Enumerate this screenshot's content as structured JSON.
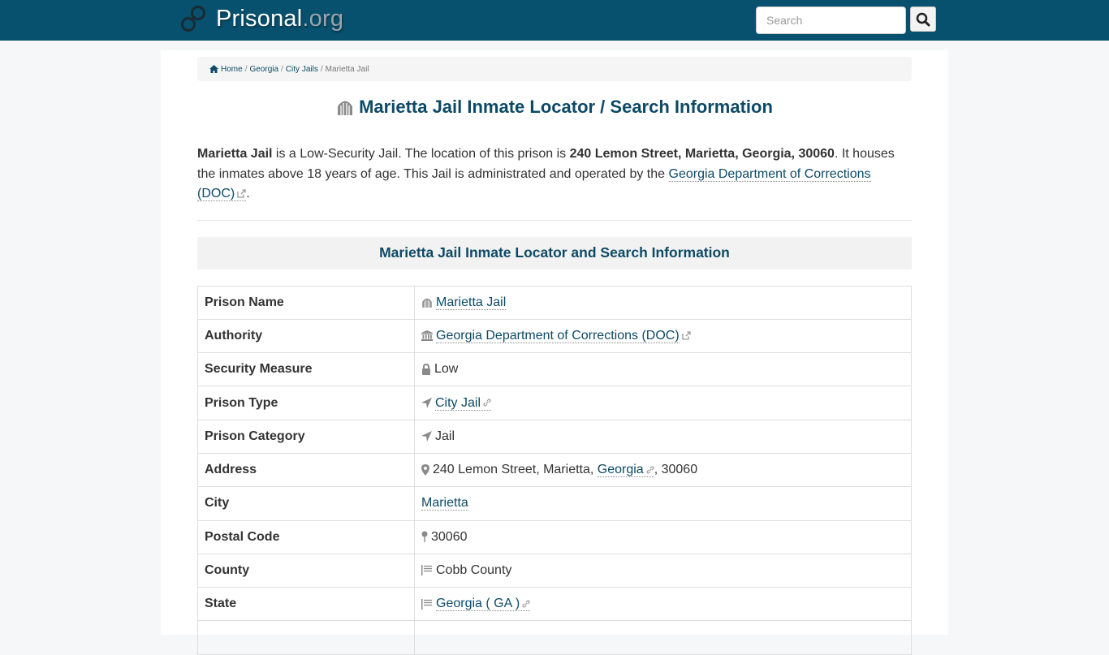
{
  "header": {
    "brand_name": "Prisonal",
    "brand_tld": ".org",
    "search_placeholder": "Search",
    "search_value": ""
  },
  "breadcrumb": {
    "items": [
      {
        "label": "Home",
        "icon": "home-icon"
      },
      {
        "label": "Georgia"
      },
      {
        "label": "City Jails"
      }
    ],
    "current": "Marietta Jail",
    "separator": "/"
  },
  "title": "Marietta Jail Inmate Locator / Search Information",
  "intro": {
    "name": "Marietta Jail",
    "text1": " is a Low-Security Jail. The location of this prison is ",
    "address": "240 Lemon Street, Marietta, Georgia, 30060",
    "text2": ". It houses the inmates above 18 years of age. This Jail is administrated and operated by the ",
    "authority_link": "Georgia Department of Corrections (DOC)",
    "text3": "."
  },
  "section_heading": "Marietta Jail Inmate Locator and Search Information",
  "table": {
    "rows": [
      {
        "key": "Prison Name",
        "icon": "prison-icon",
        "value": "Marietta Jail",
        "link": true
      },
      {
        "key": "Authority",
        "icon": "bank-icon",
        "value": "Georgia Department of Corrections (DOC)",
        "link": true,
        "external": true
      },
      {
        "key": "Security Measure",
        "icon": "lock-icon",
        "value": "Low"
      },
      {
        "key": "Prison Type",
        "icon": "location-arrow-icon",
        "value": "City Jail",
        "link": true,
        "chain": true
      },
      {
        "key": "Prison Category",
        "icon": "location-arrow-icon",
        "value": "Jail"
      },
      {
        "key": "Address",
        "icon": "map-marker-icon",
        "value_prefix": "240 Lemon Street, Marietta, ",
        "value": "Georgia",
        "value_suffix": ", 30060",
        "link": true,
        "chain": true
      },
      {
        "key": "City",
        "value": "Marietta",
        "link": true
      },
      {
        "key": "Postal Code",
        "icon": "map-pin-icon",
        "value": "30060"
      },
      {
        "key": "County",
        "icon": "flag-icon",
        "value": "Cobb County"
      },
      {
        "key": "State",
        "icon": "flag-icon",
        "value": "Georgia ( GA )",
        "link": true,
        "chain": true
      }
    ]
  },
  "colors": {
    "header_bg": "#07506e",
    "link": "#0d4a66",
    "heading": "#0d4a66"
  }
}
